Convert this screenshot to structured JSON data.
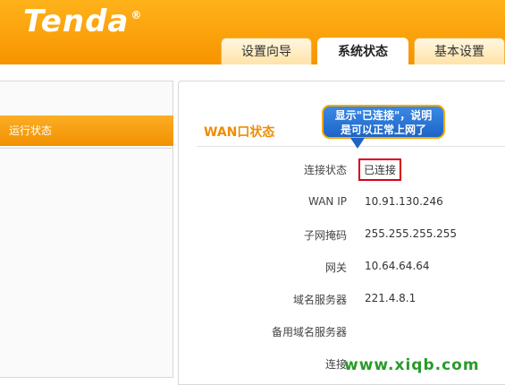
{
  "header": {
    "logo_text": "Tenda",
    "logo_mark": "®",
    "tabs": [
      {
        "label": "设置向导",
        "active": false
      },
      {
        "label": "系统状态",
        "active": true
      },
      {
        "label": "基本设置",
        "active": false
      }
    ]
  },
  "sidebar": {
    "items": [
      {
        "label": "运行状态",
        "active": true
      }
    ]
  },
  "main": {
    "section_title": "WAN口状态",
    "rows": [
      {
        "label": "连接状态",
        "value": "已连接"
      },
      {
        "label": "WAN IP",
        "value": "10.91.130.246"
      },
      {
        "label": "子网掩码",
        "value": "255.255.255.255"
      },
      {
        "label": "网关",
        "value": "10.64.64.64"
      },
      {
        "label": "域名服务器",
        "value": "221.4.8.1"
      },
      {
        "label": "备用域名服务器",
        "value": ""
      },
      {
        "label": "连接",
        "value": ""
      }
    ]
  },
  "callout": {
    "line1": "显示\"已连接\"，说明",
    "line2": "是可以正常上网了"
  },
  "watermark": "www.xiqb.com",
  "colors": {
    "brand_orange": "#f79400",
    "title_orange": "#f08c00",
    "highlight_red": "#d8001a",
    "callout_blue": "#1f64c4",
    "watermark_green": "#2a9a2a"
  }
}
